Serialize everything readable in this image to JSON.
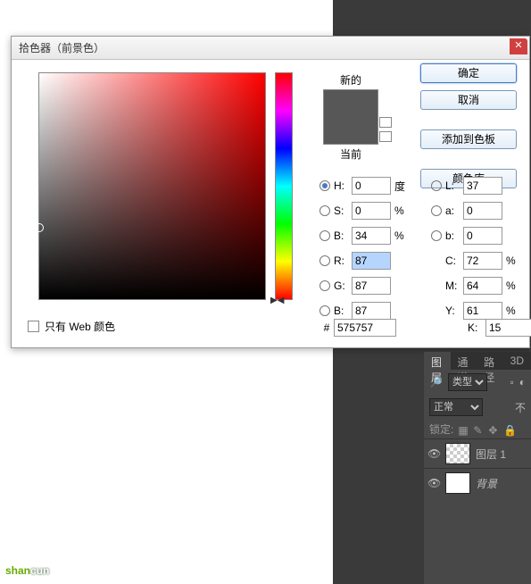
{
  "dialog": {
    "title": "拾色器（前景色）",
    "new_label": "新的",
    "current_label": "当前",
    "buttons": {
      "ok": "确定",
      "cancel": "取消",
      "add_swatch": "添加到色板",
      "color_lib": "颜色库"
    },
    "hsb": {
      "h": "0",
      "h_unit": "度",
      "s": "0",
      "s_unit": "%",
      "b": "34",
      "b_unit": "%"
    },
    "rgb": {
      "r": "87",
      "g": "87",
      "b": "87"
    },
    "lab": {
      "l": "37",
      "a": "0",
      "b": "0"
    },
    "cmyk": {
      "c": "72",
      "m": "64",
      "y": "61",
      "k": "15",
      "unit": "%"
    },
    "hex_prefix": "#",
    "hex": "575757",
    "web_only": "只有 Web 颜色",
    "labels": {
      "H": "H:",
      "S": "S:",
      "B": "B:",
      "R": "R:",
      "G": "G:",
      "B2": "B:",
      "L": "L:",
      "a": "a:",
      "b": "b:",
      "C": "C:",
      "M": "M:",
      "Y": "Y:",
      "K": "K:"
    }
  },
  "panels": {
    "tabs": {
      "layers": "图层",
      "channels": "通道",
      "paths": "路径",
      "3d": "3D"
    },
    "type_label": "类型",
    "blend_mode": "正常",
    "opacity_label": "不",
    "lock_label": "锁定:",
    "layer1": "图层 1",
    "background": "背景"
  },
  "watermark": {
    "p1": "shan",
    "p2": "cun"
  }
}
